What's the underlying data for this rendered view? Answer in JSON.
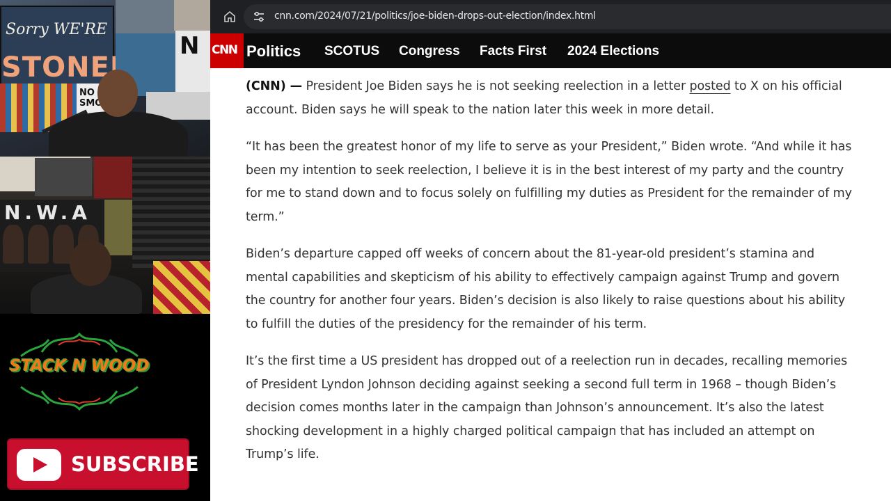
{
  "overlay": {
    "poster_sign": {
      "line1": "Sorry WE'RE",
      "line2": "STONED"
    },
    "poster_letters": "N",
    "poster_no": "NO SMOK",
    "poster_nwa": "N.W.A",
    "logo_text": "STACK N WOOD",
    "subscribe_label": "SUBSCRIBE"
  },
  "browser": {
    "url": "cnn.com/2024/07/21/politics/joe-biden-drops-out-election/index.html"
  },
  "cnn_nav": {
    "logo": "CNN",
    "section": "Politics",
    "items": [
      "SCOTUS",
      "Congress",
      "Facts First",
      "2024 Elections"
    ]
  },
  "article": {
    "p1_lead": "(CNN) —",
    "p1_before_link": " President Joe Biden says he is not seeking reelection in a letter ",
    "p1_link": "posted",
    "p1_after_link": " to X on his official account. Biden says he will speak to the nation later this week in more detail.",
    "p2": "“It has been the greatest honor of my life to serve as your President,” Biden wrote. “And while it has been my intention to seek reelection, I believe it is in the best interest of my party and the country for me to stand down and to focus solely on fulfilling my duties as President for the remainder of my term.”",
    "p3": "Biden’s departure capped off weeks of concern about the 81-year-old president’s stamina and mental capabilities and skepticism of his ability to effectively campaign against Trump and govern the country for another four years. Biden’s decision is also likely to raise questions about his ability to fulfill the duties of the presidency for the remainder of his term.",
    "p4": "It’s the first time a US president has dropped out of a reelection run in decades, recalling memories of President Lyndon Johnson deciding against seeking a second full term in 1968 – though Biden’s decision comes months later in the campaign than Johnson’s announcement. It’s also the latest shocking development in a highly charged political campaign that has included an attempt on Trump’s life."
  },
  "colors": {
    "cnn_red": "#cc0000",
    "nav_bg": "#0c0c0c",
    "chrome_bg": "#1f2023",
    "subscribe_red": "#c8102e"
  }
}
